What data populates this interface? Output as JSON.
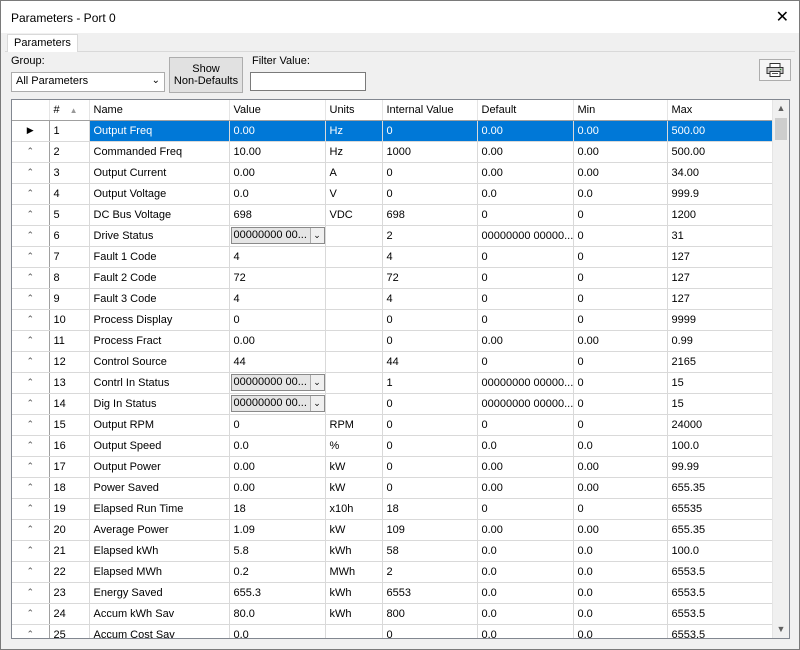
{
  "window": {
    "title": "Parameters -  Port 0",
    "close_glyph": "✕"
  },
  "tabs": [
    {
      "label": "Parameters"
    }
  ],
  "toolbar": {
    "group_label": "Group:",
    "group_value": "All Parameters",
    "show_btn_line1": "Show",
    "show_btn_line2": "Non-Defaults",
    "filter_label": "Filter Value:",
    "filter_value": "",
    "print_icon": "printer-icon"
  },
  "grid": {
    "columns": [
      "#",
      "Name",
      "Value",
      "Units",
      "Internal Value",
      "Default",
      "Min",
      "Max"
    ],
    "selected_row": 0,
    "rows": [
      {
        "num": "1",
        "name": "Output Freq",
        "value": "0.00",
        "units": "Hz",
        "internal": "0",
        "default": "0.00",
        "min": "0.00",
        "max": "500.00"
      },
      {
        "num": "2",
        "name": "Commanded Freq",
        "value": "10.00",
        "units": "Hz",
        "internal": "1000",
        "default": "0.00",
        "min": "0.00",
        "max": "500.00"
      },
      {
        "num": "3",
        "name": "Output Current",
        "value": "0.00",
        "units": "A",
        "internal": "0",
        "default": "0.00",
        "min": "0.00",
        "max": "34.00"
      },
      {
        "num": "4",
        "name": "Output Voltage",
        "value": "0.0",
        "units": "V",
        "internal": "0",
        "default": "0.0",
        "min": "0.0",
        "max": "999.9"
      },
      {
        "num": "5",
        "name": "DC Bus Voltage",
        "value": "698",
        "units": "VDC",
        "internal": "698",
        "default": "0",
        "min": "0",
        "max": "1200"
      },
      {
        "num": "6",
        "name": "Drive Status",
        "value": "00000000 00...",
        "units": "",
        "internal": "2",
        "default": "00000000 00000...",
        "min": "0",
        "max": "31",
        "combo": true
      },
      {
        "num": "7",
        "name": "Fault 1 Code",
        "value": "4",
        "units": "",
        "internal": "4",
        "default": "0",
        "min": "0",
        "max": "127"
      },
      {
        "num": "8",
        "name": "Fault 2 Code",
        "value": "72",
        "units": "",
        "internal": "72",
        "default": "0",
        "min": "0",
        "max": "127"
      },
      {
        "num": "9",
        "name": "Fault 3 Code",
        "value": "4",
        "units": "",
        "internal": "4",
        "default": "0",
        "min": "0",
        "max": "127"
      },
      {
        "num": "10",
        "name": "Process Display",
        "value": "0",
        "units": "",
        "internal": "0",
        "default": "0",
        "min": "0",
        "max": "9999"
      },
      {
        "num": "11",
        "name": "Process Fract",
        "value": "0.00",
        "units": "",
        "internal": "0",
        "default": "0.00",
        "min": "0.00",
        "max": "0.99"
      },
      {
        "num": "12",
        "name": "Control Source",
        "value": "44",
        "units": "",
        "internal": "44",
        "default": "0",
        "min": "0",
        "max": "2165"
      },
      {
        "num": "13",
        "name": "Contrl In Status",
        "value": "00000000 00...",
        "units": "",
        "internal": "1",
        "default": "00000000 00000...",
        "min": "0",
        "max": "15",
        "combo": true
      },
      {
        "num": "14",
        "name": "Dig In Status",
        "value": "00000000 00...",
        "units": "",
        "internal": "0",
        "default": "00000000 00000...",
        "min": "0",
        "max": "15",
        "combo": true
      },
      {
        "num": "15",
        "name": "Output RPM",
        "value": "0",
        "units": "RPM",
        "internal": "0",
        "default": "0",
        "min": "0",
        "max": "24000"
      },
      {
        "num": "16",
        "name": "Output Speed",
        "value": "0.0",
        "units": "%",
        "internal": "0",
        "default": "0.0",
        "min": "0.0",
        "max": "100.0"
      },
      {
        "num": "17",
        "name": "Output Power",
        "value": "0.00",
        "units": "kW",
        "internal": "0",
        "default": "0.00",
        "min": "0.00",
        "max": "99.99"
      },
      {
        "num": "18",
        "name": "Power Saved",
        "value": "0.00",
        "units": "kW",
        "internal": "0",
        "default": "0.00",
        "min": "0.00",
        "max": "655.35"
      },
      {
        "num": "19",
        "name": "Elapsed Run Time",
        "value": "18",
        "units": "x10h",
        "internal": "18",
        "default": "0",
        "min": "0",
        "max": "65535"
      },
      {
        "num": "20",
        "name": "Average Power",
        "value": "1.09",
        "units": "kW",
        "internal": "109",
        "default": "0.00",
        "min": "0.00",
        "max": "655.35"
      },
      {
        "num": "21",
        "name": "Elapsed kWh",
        "value": "5.8",
        "units": "kWh",
        "internal": "58",
        "default": "0.0",
        "min": "0.0",
        "max": "100.0"
      },
      {
        "num": "22",
        "name": "Elapsed MWh",
        "value": "0.2",
        "units": "MWh",
        "internal": "2",
        "default": "0.0",
        "min": "0.0",
        "max": "6553.5"
      },
      {
        "num": "23",
        "name": "Energy Saved",
        "value": "655.3",
        "units": "kWh",
        "internal": "6553",
        "default": "0.0",
        "min": "0.0",
        "max": "6553.5"
      },
      {
        "num": "24",
        "name": "Accum kWh Sav",
        "value": "80.0",
        "units": "kWh",
        "internal": "800",
        "default": "0.0",
        "min": "0.0",
        "max": "6553.5"
      },
      {
        "num": "25",
        "name": "Accum Cost Sav",
        "value": "0.0",
        "units": "",
        "internal": "0",
        "default": "0.0",
        "min": "0.0",
        "max": "6553.5"
      }
    ]
  }
}
